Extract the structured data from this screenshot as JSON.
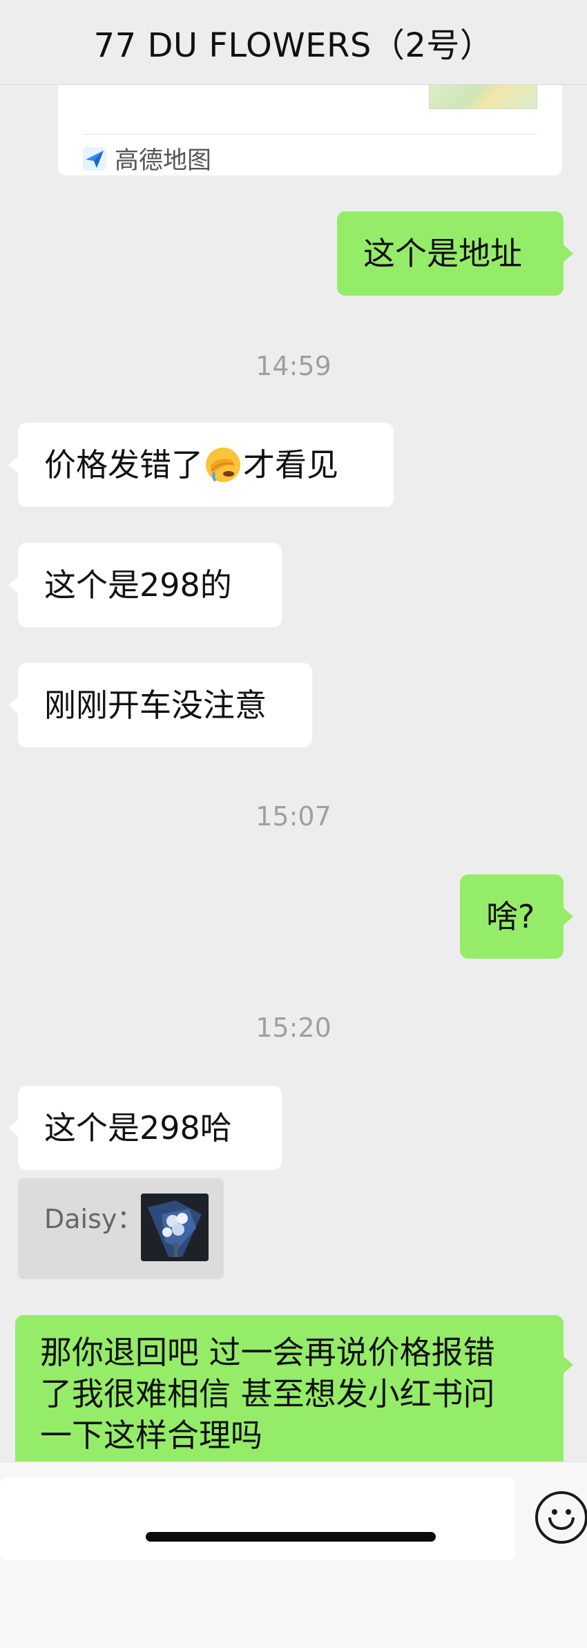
{
  "header": {
    "title": "77 DU FLOWERS（2号）"
  },
  "map_card": {
    "source_label": "高德地图",
    "icon": "amap-arrow-icon"
  },
  "messages": [
    {
      "type": "out",
      "text": "这个是地址"
    },
    {
      "type": "time",
      "text": "14:59"
    },
    {
      "type": "in",
      "text_before": "价格发错了",
      "emoji": "facepalm-cry-emoji",
      "text_after": "才看见"
    },
    {
      "type": "in",
      "text": "这个是298的"
    },
    {
      "type": "in",
      "text": "刚刚开车没注意"
    },
    {
      "type": "time",
      "text": "15:07"
    },
    {
      "type": "out",
      "text": "啥?"
    },
    {
      "type": "time",
      "text": "15:20"
    },
    {
      "type": "in",
      "text": "这个是298哈"
    },
    {
      "type": "quote",
      "name": "Daisy：",
      "image": "bouquet-thumbnail"
    },
    {
      "type": "out",
      "lines": [
        "那你退回吧 过一会再说价格报错",
        "了我很难相信 甚至想发小红书问",
        "一下这样合理吗"
      ]
    }
  ],
  "input_bar": {
    "value": "",
    "emoji_button": "emoji-smile-icon"
  },
  "colors": {
    "outgoing_bubble": "#95ec69",
    "incoming_bubble": "#ffffff",
    "background": "#ededed"
  }
}
